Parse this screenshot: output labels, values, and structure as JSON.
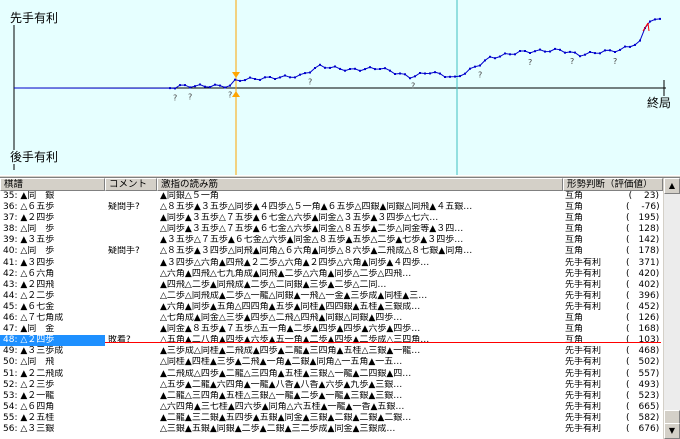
{
  "chart": {
    "top_label": "先手有利",
    "bottom_label": "後手有利",
    "end_label": "終局"
  },
  "list": {
    "headers": {
      "move": "棋譜",
      "comment": "コメント",
      "line": "激指の読み筋",
      "eval": "形勢判断（評価値）"
    },
    "rows": [
      {
        "move": "35: ▲同　銀",
        "comment": "",
        "line": "▲同銀△５一角",
        "eval": "互角",
        "score": "(　 23)"
      },
      {
        "move": "36: △６五歩",
        "comment": "疑問手?",
        "line": "△８五歩▲３五歩△同歩▲４四歩△５一角▲６五歩△四銀▲同銀△同飛▲４五銀…",
        "eval": "互角",
        "score": "(　 -76)"
      },
      {
        "move": "37: ▲２四歩",
        "comment": "",
        "line": "▲同歩▲３五歩△７五歩▲６七金△六歩▲同金△３五歩▲３四歩△七六…",
        "eval": "互角",
        "score": "(　195)"
      },
      {
        "move": "38: △同　歩",
        "comment": "",
        "line": "△同歩▲３五歩△７五歩▲６七金△六歩▲同金△８五歩▲二歩△同金等▲３四…",
        "eval": "互角",
        "score": "(　128)"
      },
      {
        "move": "39: ▲３五歩",
        "comment": "",
        "line": "▲３五歩△７五歩▲６七金△六歩▲同金△８五歩▲五歩△二歩▲七歩▲３四歩…",
        "eval": "互角",
        "score": "(　142)"
      },
      {
        "move": "40: △同　歩",
        "comment": "疑問手?",
        "line": "△８五歩▲３四歩△同飛▲同角△６六角▲同歩△８六歩▲二飛成△８七銀▲同角…",
        "eval": "互角",
        "score": "(　178)"
      },
      {
        "move": "41: ▲３四歩",
        "comment": "",
        "line": "▲３四歩△六角▲四飛▲２二歩△六角▲２四歩△六角▲同歩▲４四歩…",
        "eval": "先手有利",
        "score": "(　371)"
      },
      {
        "move": "42: △６六角",
        "comment": "",
        "line": "△六角▲四飛△七九角成▲同飛▲二歩△六角▲同歩△二歩△四飛…",
        "eval": "先手有利",
        "score": "(　420)"
      },
      {
        "move": "43: ▲２四飛",
        "comment": "",
        "line": "▲四飛△二歩▲同飛成▲二歩△二同銀▲三歩▲二歩△二同…",
        "eval": "先手有利",
        "score": "(　402)"
      },
      {
        "move": "44: △２二歩",
        "comment": "",
        "line": "△二歩△同飛成▲二歩△一龍△同銀▲一飛△一金▲三歩成▲同桂▲三…",
        "eval": "先手有利",
        "score": "(　396)"
      },
      {
        "move": "45: ▲６七金",
        "comment": "",
        "line": "▲六角▲同歩▲五角△四四角▲五歩▲同桂▲四四銀▲五桂▲三銀成…",
        "eval": "先手有利",
        "score": "(　452)"
      },
      {
        "move": "46: △７七角成",
        "comment": "",
        "line": "△七角成▲同金△三歩▲四歩△二飛△四飛▲同銀△同銀▲四歩…",
        "eval": "互角",
        "score": "(　126)"
      },
      {
        "move": "47: ▲同　金",
        "comment": "",
        "line": "▲同金▲８五歩▲７五歩△五一角▲二歩▲四歩▲四歩▲六歩▲四歩…",
        "eval": "互角",
        "score": "(　168)"
      },
      {
        "move": "48: △２四歩",
        "comment": "敗着?",
        "line": "△五角▲二八角▲四歩▲六歩▲五一角▲二歩▲四歩▲二歩成△三四角…",
        "eval": "互角",
        "score": "(　103)"
      },
      {
        "move": "49: ▲３三歩成",
        "comment": "",
        "line": "▲三歩成△同桂▲二飛成▲四歩▲二龍▲三四角▲五桂△三銀▲一龍…",
        "eval": "先手有利",
        "score": "(　468)"
      },
      {
        "move": "50: △同　飛",
        "comment": "",
        "line": "△同桂▲四桂▲三歩▲二飛▲一角▲二銀▲同角△一五角▲一五…",
        "eval": "先手有利",
        "score": "(　502)"
      },
      {
        "move": "51: ▲２二飛成",
        "comment": "",
        "line": "▲二飛成△四歩▲二龍△三四角▲五桂▲三銀△一龍▲二四銀▲四…",
        "eval": "先手有利",
        "score": "(　557)"
      },
      {
        "move": "52: △２三歩",
        "comment": "",
        "line": "△五歩▲二龍▲六四角▲一龍▲八香▲八香▲六歩▲九歩▲三銀…",
        "eval": "先手有利",
        "score": "(　493)"
      },
      {
        "move": "53: ▲２一龍",
        "comment": "",
        "line": "▲二龍△三四角▲五桂△三銀△一龍▲二歩▲一龍▲三銀▲三銀…",
        "eval": "先手有利",
        "score": "(　523)"
      },
      {
        "move": "54: △６四角",
        "comment": "",
        "line": "△六四角▲三七桂▲四六歩▲同角△六五桂▲一龍▲一香▲五銀…",
        "eval": "先手有利",
        "score": "(　665)"
      },
      {
        "move": "55: ▲２五桂",
        "comment": "",
        "line": "▲二龍▲三二銀▲五四歩▲五銀▲同金▲三銀▲二銀▲二銀▲二銀…",
        "eval": "先手有利",
        "score": "(　582)"
      },
      {
        "move": "56: △３三銀",
        "comment": "",
        "line": "△三銀▲五銀▲同銀▲二歩▲二銀▲三二歩成▲同金▲三銀成…",
        "eval": "先手有利",
        "score": "(　676)"
      }
    ]
  }
}
